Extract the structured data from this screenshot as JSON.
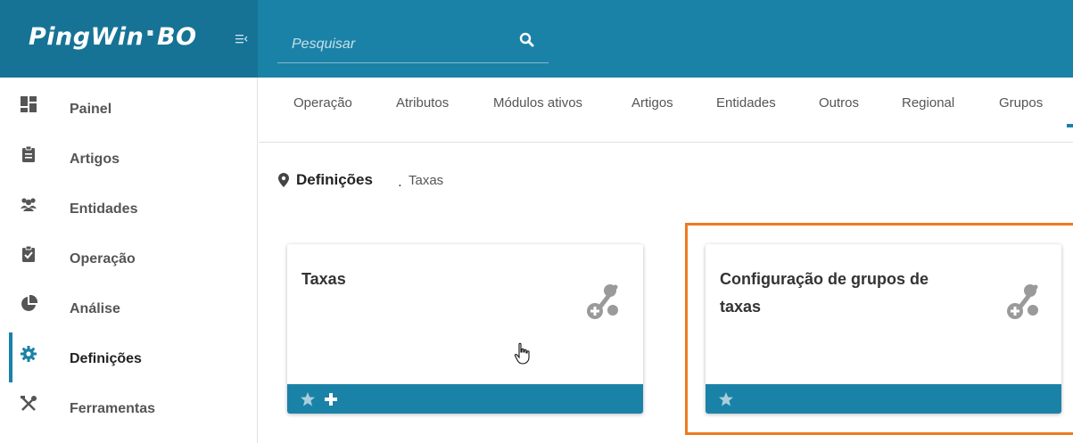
{
  "header": {
    "logo_left": "PingWin",
    "logo_right": "BO",
    "search": {
      "placeholder": "Pesquisar",
      "value": ""
    }
  },
  "sidebar": {
    "items": [
      {
        "label": "Painel",
        "icon": "dashboard-icon"
      },
      {
        "label": "Artigos",
        "icon": "clipboard-icon"
      },
      {
        "label": "Entidades",
        "icon": "users-icon"
      },
      {
        "label": "Operação",
        "icon": "clipboard-check-icon"
      },
      {
        "label": "Análise",
        "icon": "pie-chart-icon"
      },
      {
        "label": "Definições",
        "icon": "gear-icon",
        "active": true
      },
      {
        "label": "Ferramentas",
        "icon": "tools-icon"
      }
    ]
  },
  "tabs": [
    {
      "label": "Operação"
    },
    {
      "label": "Atributos"
    },
    {
      "label": "Módulos ativos"
    },
    {
      "label": "Artigos"
    },
    {
      "label": "Entidades"
    },
    {
      "label": "Outros"
    },
    {
      "label": "Regional"
    },
    {
      "label": "Grupos"
    }
  ],
  "breadcrumb": {
    "main": "Definições",
    "separator": ".",
    "sub": "Taxas"
  },
  "cards": [
    {
      "title": "Taxas",
      "icon": "percent-add-icon",
      "footer": [
        "star-icon",
        "plus-icon"
      ]
    },
    {
      "title_line1": "Configuração de grupos de",
      "title_line2": "taxas",
      "icon": "percent-add-icon",
      "footer": [
        "star-icon"
      ]
    }
  ],
  "colors": {
    "brand": "#1b82a7",
    "brand_dark": "#167396",
    "highlight": "#f0791f"
  }
}
